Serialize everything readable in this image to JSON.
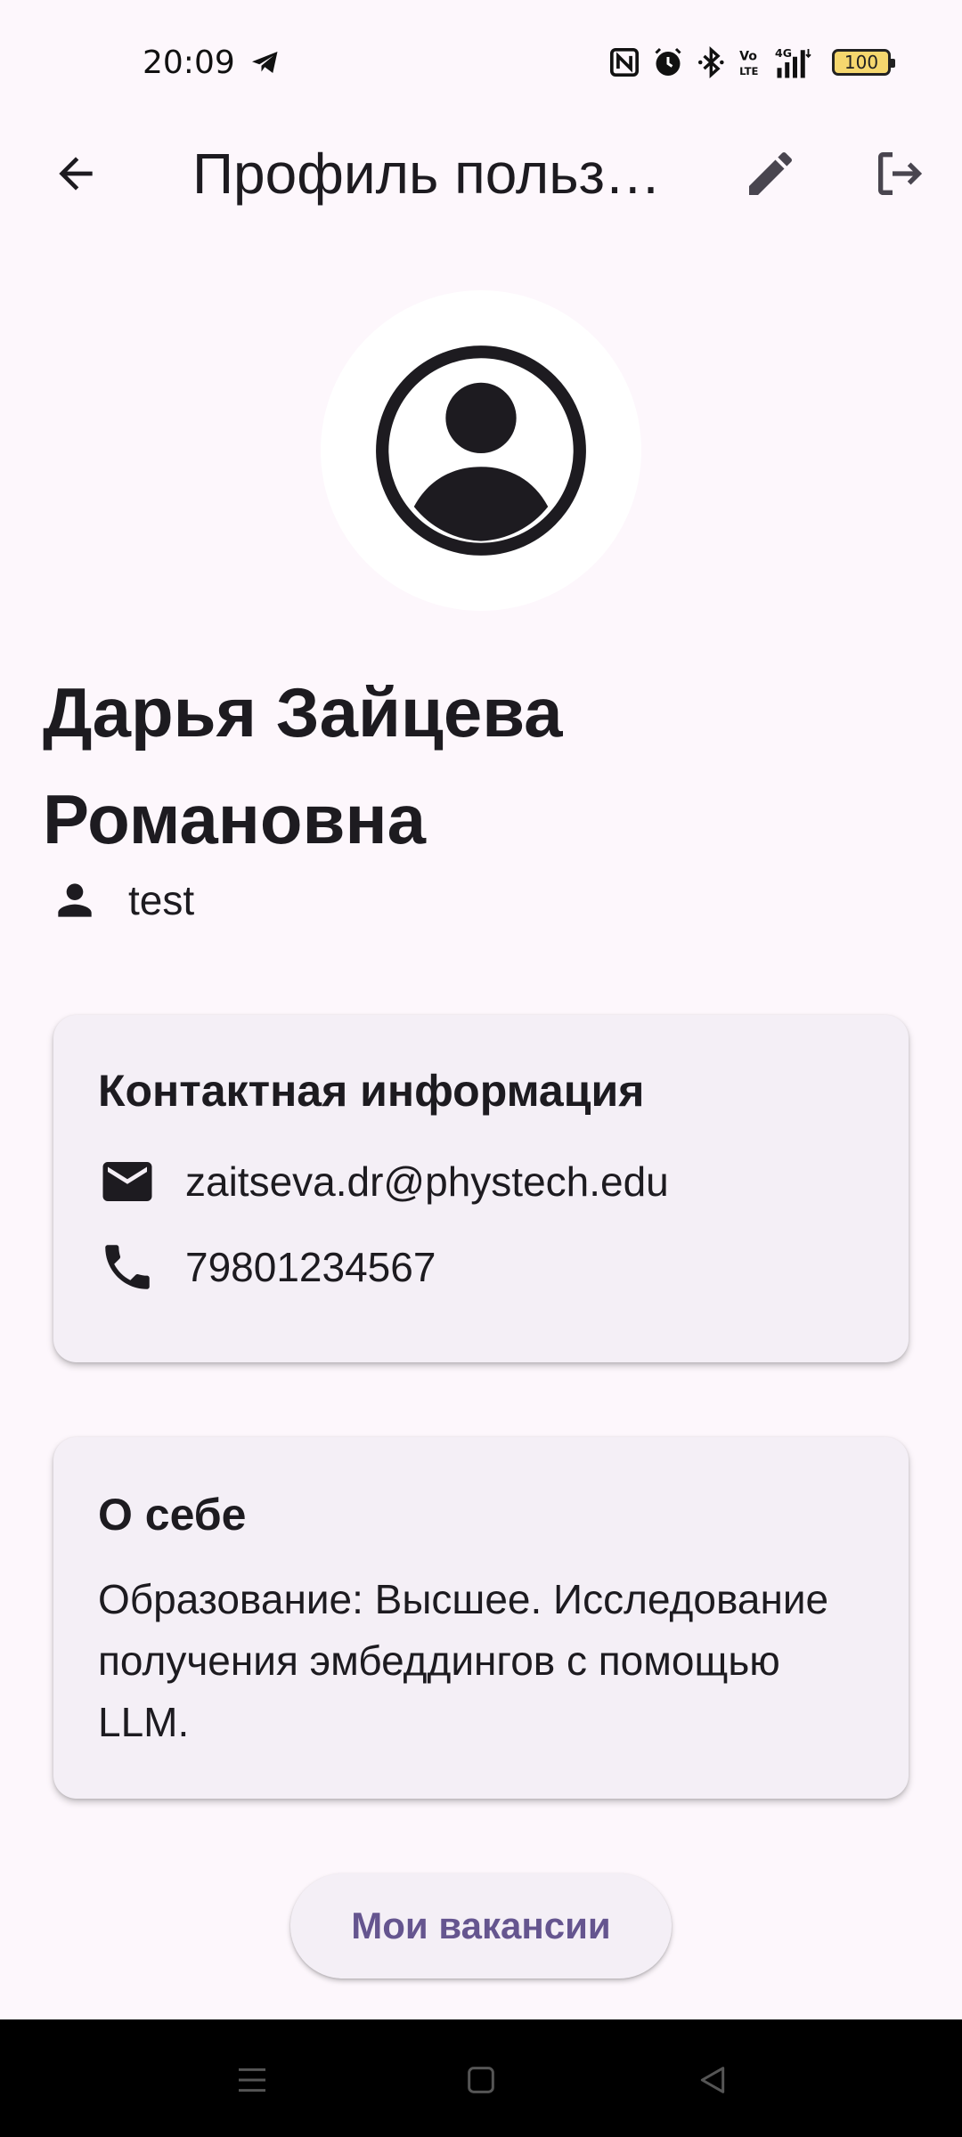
{
  "status_bar": {
    "time": "20:09",
    "battery": "100",
    "icons": [
      "telegram-icon",
      "nfc-icon",
      "alarm-icon",
      "bluetooth-icon",
      "volte-icon",
      "signal-4g-icon",
      "battery-icon"
    ]
  },
  "app_bar": {
    "title": "Профиль пользователя",
    "back_icon": "arrow-back-icon",
    "edit_icon": "edit-pencil-icon",
    "logout_icon": "logout-icon"
  },
  "profile": {
    "full_name": "Дарья Зайцева Романовна",
    "username": "test",
    "avatar_icon": "account-circle-icon",
    "username_icon": "person-icon"
  },
  "contacts": {
    "title": "Контактная информация",
    "email": "zaitseva.dr@phystech.edu",
    "phone": "79801234567",
    "email_icon": "mail-icon",
    "phone_icon": "phone-icon"
  },
  "about": {
    "title": "О себе",
    "text": "Образование: Высшее. Исследование получения эмбеддингов с помощью LLM."
  },
  "actions": {
    "vacancies_label": "Мои вакансии"
  },
  "colors": {
    "background": "#fdf7fc",
    "card": "#f4eff6",
    "accent": "#65558f",
    "text": "#1d1b20"
  }
}
